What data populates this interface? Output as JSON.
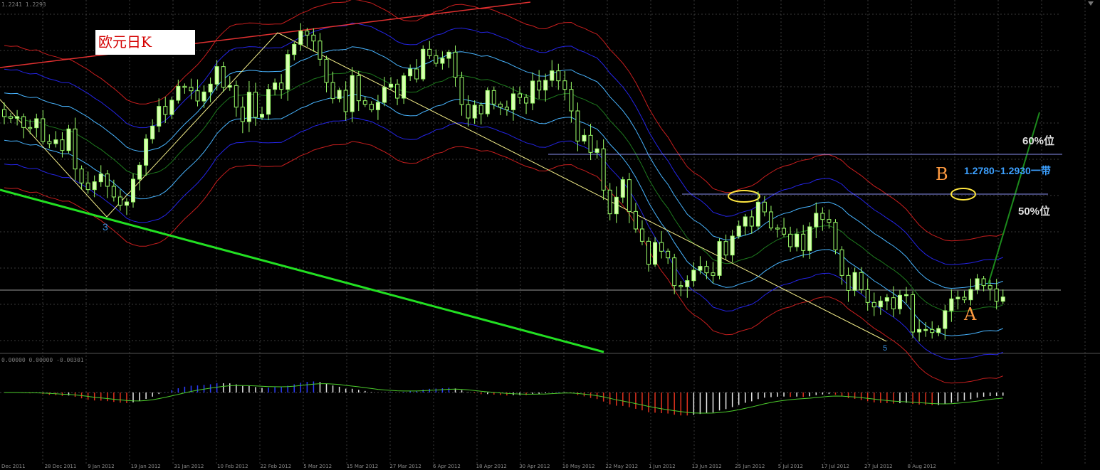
{
  "header_values": {
    "price": "1.2241 1.2293",
    "macd": "0.00000 0.00000 -0.00301"
  },
  "chart_title": "欧元日K",
  "annotations": {
    "level_60": "60%位",
    "level_50": "50%位",
    "zone": "1.2780~1.2930一带",
    "wave_3": "3",
    "wave_5": "5",
    "label_a": "A",
    "label_b": "B"
  },
  "colors": {
    "background": "#000000",
    "grid": "#3a3a3a",
    "candle_body": "#d8ffb0",
    "candle_wick": "#9cff6a",
    "trend_upper": "#e03030",
    "trend_lower": "#22e022",
    "zigzag": "#f4ee8a",
    "projection": "#1c8a1c",
    "levels": "#8a8ff0",
    "ellipse": "#ffe640",
    "bb_outer": "#c81e1e",
    "bb_mid": "#2424e6",
    "bb_inner": "#48b4ff",
    "ma": "#1e7a1e",
    "macd_red": "#e0321e",
    "macd_white": "#e8e8e8",
    "macd_blue": "#2c3cff",
    "macd_signal": "#4ccc2c"
  },
  "chart_data": {
    "type": "candlestick",
    "instrument": "EUR/USD daily",
    "price_range": [
      1.2061,
      1.3546
    ],
    "x_dates": [
      "Dec 2011",
      "28 Dec 2011",
      "9 Jan 2012",
      "19 Jan 2012",
      "31 Jan 2012",
      "10 Feb 2012",
      "22 Feb 2012",
      "5 Mar 2012",
      "15 Mar 2012",
      "27 Mar 2012",
      "6 Apr 2012",
      "18 Apr 2012",
      "30 Apr 2012",
      "10 May 2012",
      "22 May 2012",
      "1 Jun 2012",
      "13 Jun 2012",
      "25 Jun 2012",
      "5 Jul 2012",
      "17 Jul 2012",
      "27 Jul 2012",
      "8 Aug 2012"
    ],
    "closes": [
      1.3054,
      1.3047,
      1.3054,
      1.3008,
      1.3007,
      1.3045,
      1.2949,
      1.294,
      1.2956,
      1.2911,
      1.3002,
      1.2833,
      1.2774,
      1.2746,
      1.2779,
      1.2812,
      1.276,
      1.2715,
      1.268,
      1.2694,
      1.279,
      1.2849,
      1.296,
      1.3014,
      1.3097,
      1.3063,
      1.3123,
      1.3182,
      1.3177,
      1.3163,
      1.312,
      1.3158,
      1.3191,
      1.3265,
      1.3178,
      1.3185,
      1.3094,
      1.3033,
      1.3157,
      1.3051,
      1.3064,
      1.3169,
      1.3196,
      1.3169,
      1.3316,
      1.3359,
      1.3415,
      1.3398,
      1.3373,
      1.3296,
      1.3198,
      1.313,
      1.3165,
      1.3075,
      1.3227,
      1.3121,
      1.3106,
      1.3083,
      1.3114,
      1.3178,
      1.3191,
      1.3132,
      1.3226,
      1.3255,
      1.3213,
      1.3338,
      1.3311,
      1.3279,
      1.33,
      1.3326,
      1.322,
      1.3105,
      1.3048,
      1.3102,
      1.3066,
      1.3164,
      1.3107,
      1.3094,
      1.3083,
      1.315,
      1.3135,
      1.3111,
      1.3204,
      1.3166,
      1.3207,
      1.3247,
      1.3205,
      1.3169,
      1.3078,
      1.2951,
      1.2975,
      1.2903,
      1.2918,
      1.2744,
      1.2644,
      1.2714,
      1.2788,
      1.2654,
      1.258,
      1.2528,
      1.2431,
      1.2523,
      1.2486,
      1.2458,
      1.2341,
      1.2336,
      1.2362,
      1.2406,
      1.2422,
      1.2395,
      1.2384,
      1.2527,
      1.247,
      1.255,
      1.2592,
      1.2631,
      1.2592,
      1.2693,
      1.2652,
      1.2584,
      1.2583,
      1.2558,
      1.2505,
      1.2558,
      1.2489,
      1.2589,
      1.2646,
      1.262,
      1.2608,
      1.2492,
      1.2384,
      1.2321,
      1.2396,
      1.2324,
      1.227,
      1.2251,
      1.2276,
      1.229,
      1.2243,
      1.23,
      1.2303,
      1.2145,
      1.2156,
      1.2156,
      1.2143,
      1.216,
      1.2235,
      1.2285,
      1.2292,
      1.2281,
      1.2325,
      1.237,
      1.2341,
      1.2327,
      1.2275,
      1.2293
    ]
  },
  "x_axis_labels": [
    "Dec 2011",
    "28 Dec 2011",
    "9 Jan 2012",
    "19 Jan 2012",
    "31 Jan 2012",
    "10 Feb 2012",
    "22 Feb 2012",
    "5 Mar 2012",
    "15 Mar 2012",
    "27 Mar 2012",
    "6 Apr 2012",
    "18 Apr 2012",
    "30 Apr 2012",
    "10 May 2012",
    "22 May 2012",
    "1 Jun 2012",
    "13 Jun 2012",
    "25 Jun 2012",
    "5 Jul 2012",
    "17 Jul 2012",
    "27 Jul 2012",
    "8 Aug 2012"
  ]
}
